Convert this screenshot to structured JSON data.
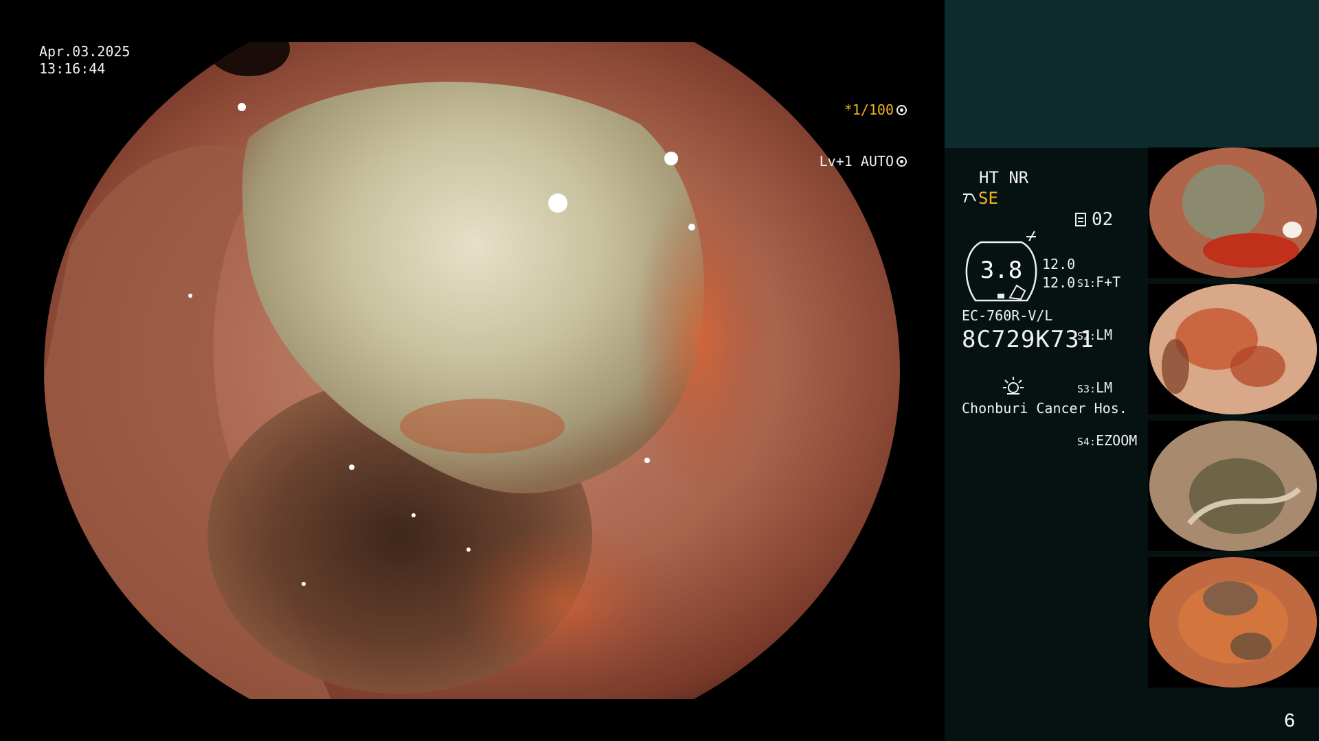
{
  "capture": {
    "date": "Apr.03.2025",
    "time": "13:16:44"
  },
  "view_status": {
    "shutter": "*1/100",
    "level": "Lv+1 AUTO"
  },
  "panel": {
    "enhancement": "HT NR",
    "se_mode": "SE",
    "counter": "02",
    "gauge_value": "3.8",
    "values": [
      "12.0",
      "12.0"
    ],
    "scope_settings": [
      {
        "label": "S1:",
        "value": "F+T"
      },
      {
        "label": "S2:",
        "value": "LM"
      },
      {
        "label": "S3:",
        "value": "LM"
      },
      {
        "label": "S4:",
        "value": "EZOOM"
      }
    ],
    "model": "EC-760R-V/L",
    "serial": "8C729K731",
    "hospital": "Chonburi Cancer Hos."
  },
  "thumbnails": [
    {
      "name": "thumbnail-1"
    },
    {
      "name": "thumbnail-2"
    },
    {
      "name": "thumbnail-3"
    },
    {
      "name": "thumbnail-4"
    }
  ],
  "page_number": "6",
  "colors": {
    "accent_amber": "#f5b323",
    "panel_bg": "#061212",
    "panel_top": "#0d2a2d"
  }
}
